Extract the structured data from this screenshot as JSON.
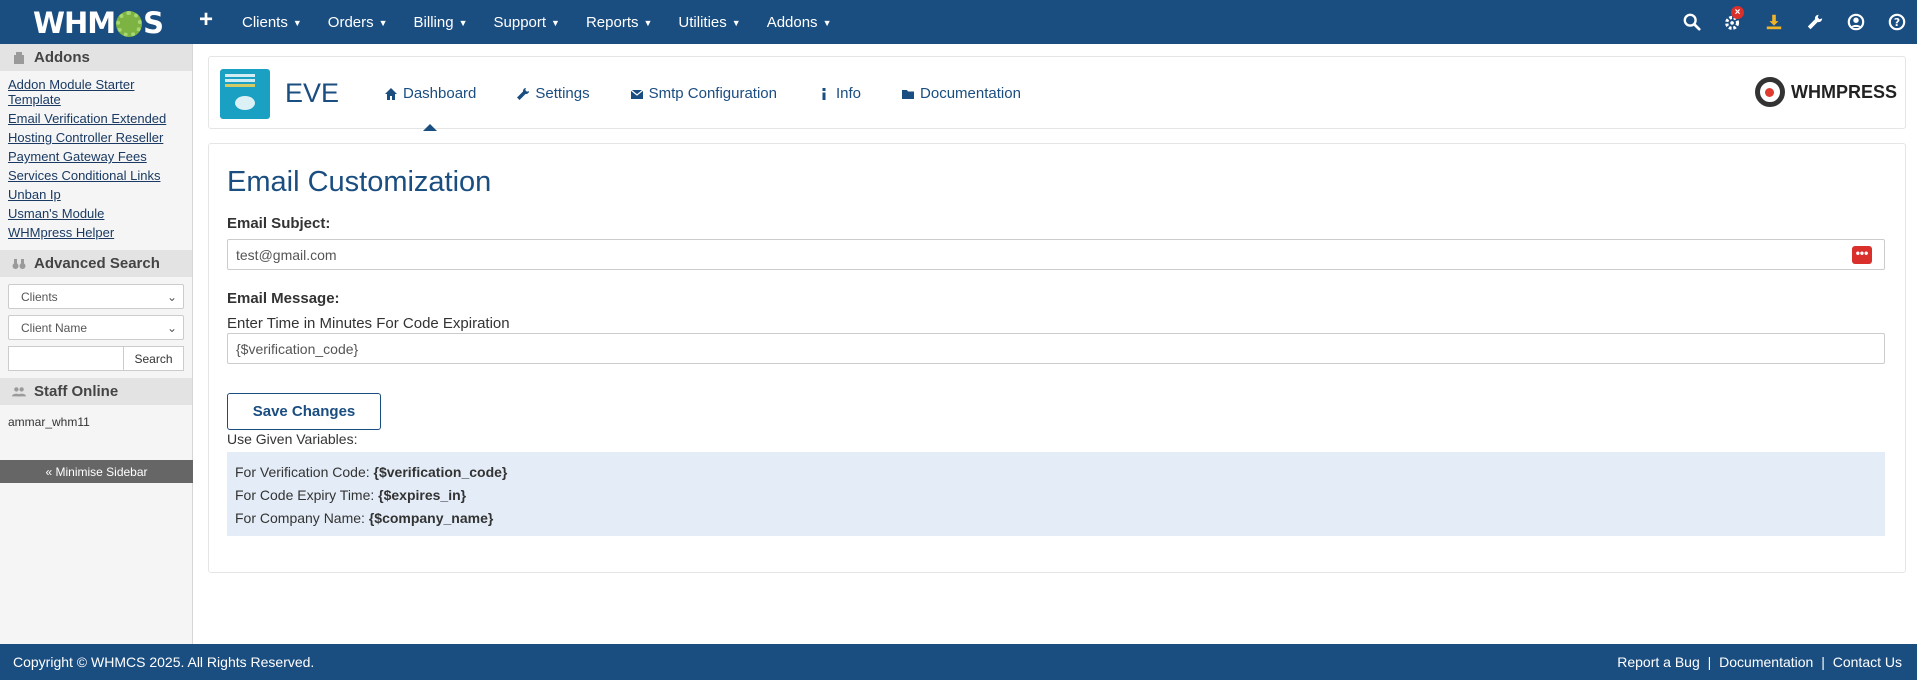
{
  "topbar": {
    "brand": {
      "left": "WHM",
      "right": "S"
    },
    "menu": [
      "Clients",
      "Orders",
      "Billing",
      "Support",
      "Reports",
      "Utilities",
      "Addons"
    ],
    "icons": [
      "search-icon",
      "gears-icon",
      "download-icon",
      "wrench-icon",
      "user-circle-icon",
      "help-icon"
    ],
    "colors": {
      "bar": "#1a4d80",
      "alert": "#d9302c",
      "download": "#f0b429"
    }
  },
  "sidebar": {
    "addons_title": "Addons",
    "addons": [
      "Addon Module Starter Template",
      "Email Verification Extended",
      "Hosting Controller Reseller",
      "Payment Gateway Fees",
      "Services Conditional Links",
      "Unban Ip",
      "Usman's Module",
      "WHMpress Helper"
    ],
    "search_title": "Advanced Search",
    "search_type": "Clients",
    "search_field": "Client Name",
    "search_button": "Search",
    "staff_title": "Staff Online",
    "staff_name": "ammar_whm11",
    "minimise": "« Minimise Sidebar"
  },
  "module": {
    "title": "EVE",
    "tabs": [
      "Dashboard",
      "Settings",
      "Smtp Configuration",
      "Info",
      "Documentation"
    ],
    "active_tab": "Dashboard",
    "partner": "WHMPRESS"
  },
  "form": {
    "title": "Email Customization",
    "subject_label": "Email Subject:",
    "subject_value": "test@gmail.com",
    "message_label": "Email Message:",
    "message_hint": "Enter Time in Minutes For Code Expiration",
    "message_value": "{$verification_code}",
    "save_button": "Save Changes",
    "variables_title": "Use Given Variables:",
    "variables": [
      {
        "label": "For Verification Code: ",
        "value": "{$verification_code}"
      },
      {
        "label": "For Code Expiry Time: ",
        "value": "{$expires_in}"
      },
      {
        "label": "For Company Name: ",
        "value": "{$company_name}"
      }
    ]
  },
  "footer": {
    "copyright": "Copyright © WHMCS 2025. All Rights Reserved.",
    "links": [
      "Report a Bug",
      "Documentation",
      "Contact Us"
    ],
    "separator": "|"
  }
}
